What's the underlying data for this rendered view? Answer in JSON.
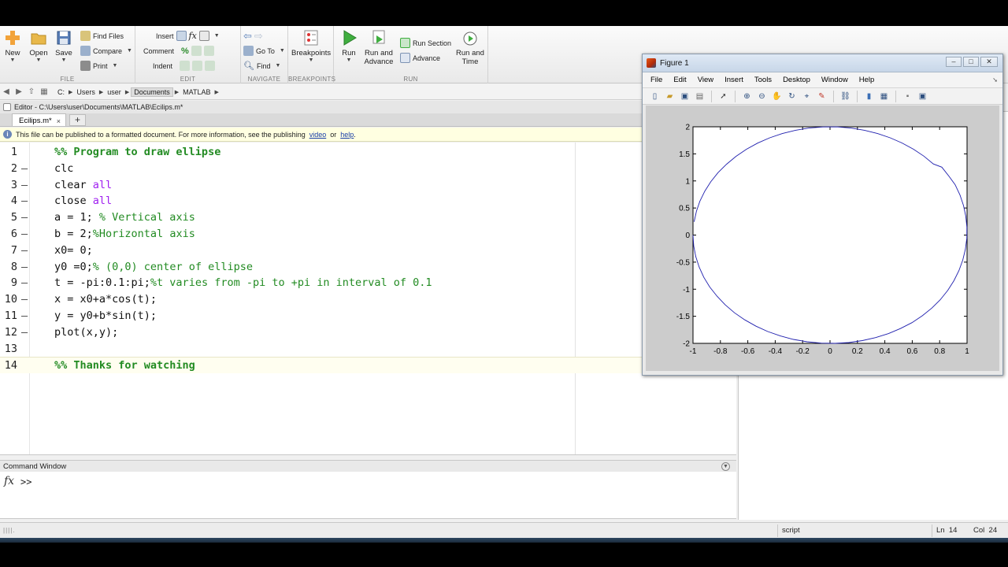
{
  "toolstrip": {
    "file": {
      "label": "FILE",
      "new": "New",
      "open": "Open",
      "save": "Save",
      "find_files": "Find Files",
      "compare": "Compare",
      "print": "Print"
    },
    "edit": {
      "label": "EDIT",
      "insert": "Insert",
      "comment": "Comment",
      "indent": "Indent",
      "fx_icon": "fx"
    },
    "navigate": {
      "label": "NAVIGATE",
      "goto": "Go To",
      "find": "Find"
    },
    "breakpoints": {
      "label": "BREAKPOINTS",
      "button": "Breakpoints"
    },
    "run": {
      "label": "RUN",
      "run": "Run",
      "run_advance_1": "Run and",
      "run_advance_2": "Advance",
      "run_section": "Run Section",
      "advance": "Advance",
      "run_time_1": "Run and",
      "run_time_2": "Time"
    }
  },
  "address": {
    "crumbs": [
      "C:",
      "Users",
      "user",
      "Documents",
      "MATLAB"
    ],
    "selected_index": 3
  },
  "editor": {
    "title": "Editor - C:\\Users\\user\\Documents\\MATLAB\\Ecilips.m*",
    "tab_label": "Ecilips.m*",
    "tab_close": "×",
    "tab_add": "+",
    "info": {
      "text": "This file can be published to a formatted document. For more information, see the publishing",
      "link1": "video",
      "or": "or",
      "link2": "help",
      "period": "."
    },
    "current_line": 14,
    "lines": [
      {
        "n": "1",
        "bp": "",
        "parts": [
          {
            "t": "%% Program to draw ellipse",
            "c": "cell"
          }
        ]
      },
      {
        "n": "2",
        "bp": "—",
        "parts": [
          {
            "t": "clc",
            "c": ""
          }
        ]
      },
      {
        "n": "3",
        "bp": "—",
        "parts": [
          {
            "t": "clear ",
            "c": ""
          },
          {
            "t": "all",
            "c": "str"
          }
        ]
      },
      {
        "n": "4",
        "bp": "—",
        "parts": [
          {
            "t": "close ",
            "c": ""
          },
          {
            "t": "all",
            "c": "str"
          }
        ]
      },
      {
        "n": "5",
        "bp": "—",
        "parts": [
          {
            "t": "a = 1; ",
            "c": ""
          },
          {
            "t": "% Vertical axis",
            "c": "com"
          }
        ]
      },
      {
        "n": "6",
        "bp": "—",
        "parts": [
          {
            "t": "b = 2;",
            "c": ""
          },
          {
            "t": "%Horizontal axis",
            "c": "com"
          }
        ]
      },
      {
        "n": "7",
        "bp": "—",
        "parts": [
          {
            "t": "x0= 0;",
            "c": ""
          }
        ]
      },
      {
        "n": "8",
        "bp": "—",
        "parts": [
          {
            "t": "y0 =0;",
            "c": ""
          },
          {
            "t": "% (0,0) center of ellipse",
            "c": "com"
          }
        ]
      },
      {
        "n": "9",
        "bp": "—",
        "parts": [
          {
            "t": "t = -pi:0.1:pi;",
            "c": ""
          },
          {
            "t": "%t varies from -pi to +pi in interval of 0.1",
            "c": "com"
          }
        ]
      },
      {
        "n": "10",
        "bp": "—",
        "parts": [
          {
            "t": "x = x0+a*cos(t);",
            "c": ""
          }
        ]
      },
      {
        "n": "11",
        "bp": "—",
        "parts": [
          {
            "t": "y = y0+b*sin(t);",
            "c": ""
          }
        ]
      },
      {
        "n": "12",
        "bp": "—",
        "parts": [
          {
            "t": "plot(x,y);",
            "c": ""
          }
        ]
      },
      {
        "n": "13",
        "bp": "",
        "parts": []
      },
      {
        "n": "14",
        "bp": "",
        "parts": [
          {
            "t": "%% Thanks for watching",
            "c": "cell"
          }
        ]
      }
    ]
  },
  "command_window": {
    "title": "Command Window",
    "fx": "fx",
    "prompt": ">>"
  },
  "status": {
    "mode": "script",
    "ln_label": "Ln",
    "ln": "14",
    "col_label": "Col",
    "col": "24"
  },
  "figure": {
    "title": "Figure 1",
    "menu": [
      "File",
      "Edit",
      "View",
      "Insert",
      "Tools",
      "Desktop",
      "Window",
      "Help"
    ],
    "toolbar_icons": [
      "new-figure-icon",
      "open-file-icon",
      "save-figure-icon",
      "print-figure-icon",
      "edit-plot-icon",
      "zoom-in-icon",
      "zoom-out-icon",
      "pan-icon",
      "rotate-3d-icon",
      "data-cursor-icon",
      "brush-icon",
      "link-plot-icon",
      "colorbar-icon",
      "legend-icon",
      "hide-plot-tools-icon",
      "show-plot-tools-icon"
    ]
  },
  "colors": {
    "comment": "#228b22",
    "string": "#a020f0",
    "plot_line": "#1f1fae",
    "accent": "#2d4f7f"
  },
  "chart_data": {
    "type": "line",
    "title": "",
    "xlabel": "",
    "ylabel": "",
    "xlim": [
      -1,
      1
    ],
    "ylim": [
      -2,
      2
    ],
    "xticks": [
      "-1",
      "-0.8",
      "-0.6",
      "-0.4",
      "-0.2",
      "0",
      "0.2",
      "0.4",
      "0.6",
      "0.8",
      "1"
    ],
    "yticks": [
      "-2",
      "-1.5",
      "-1",
      "-0.5",
      "0",
      "0.5",
      "1",
      "1.5",
      "2"
    ],
    "grid": false,
    "series": [
      {
        "x": [
          -1.0,
          -0.995,
          -0.98,
          -0.955,
          -0.921,
          -0.878,
          -0.825,
          -0.765,
          -0.697,
          -0.622,
          -0.54,
          -0.454,
          -0.362,
          -0.267,
          -0.167,
          -0.065,
          0.036,
          0.137,
          0.236,
          0.333,
          0.427,
          0.514,
          0.598,
          0.674,
          0.743,
          0.805,
          0.859,
          0.904,
          0.941,
          0.969,
          0.988,
          0.998,
          0.999,
          0.991,
          0.974,
          0.949,
          0.913,
          0.869,
          0.816,
          0.754,
          0.685,
          0.609,
          0.526,
          0.439,
          0.347,
          0.251,
          0.151,
          0.049,
          -0.052,
          -0.153,
          -0.252,
          -0.348,
          -0.44,
          -0.528,
          -0.61,
          -0.687,
          -0.756,
          -0.817,
          -0.87,
          -0.914,
          -0.95,
          -0.975,
          -0.992
        ],
        "y": [
          0.0,
          -0.2,
          -0.397,
          -0.591,
          -0.779,
          -0.959,
          -1.129,
          -1.288,
          -1.435,
          -1.567,
          -1.683,
          -1.782,
          -1.864,
          -1.927,
          -1.971,
          -1.996,
          -2.0,
          -1.985,
          -1.949,
          -1.894,
          -1.819,
          -1.727,
          -1.617,
          -1.49,
          -1.348,
          -1.192,
          -1.023,
          -0.844,
          -0.656,
          -0.46,
          -0.26,
          -0.058,
          0.146,
          0.347,
          0.545,
          0.737,
          0.93,
          1.083,
          1.254,
          1.314,
          1.457,
          1.586,
          1.7,
          1.797,
          1.875,
          1.936,
          1.977,
          1.998,
          1.997,
          1.977,
          1.936,
          1.875,
          1.796,
          1.699,
          1.585,
          1.453,
          1.307,
          1.153,
          0.986,
          0.812,
          0.624,
          0.442,
          0.246
        ]
      }
    ]
  }
}
